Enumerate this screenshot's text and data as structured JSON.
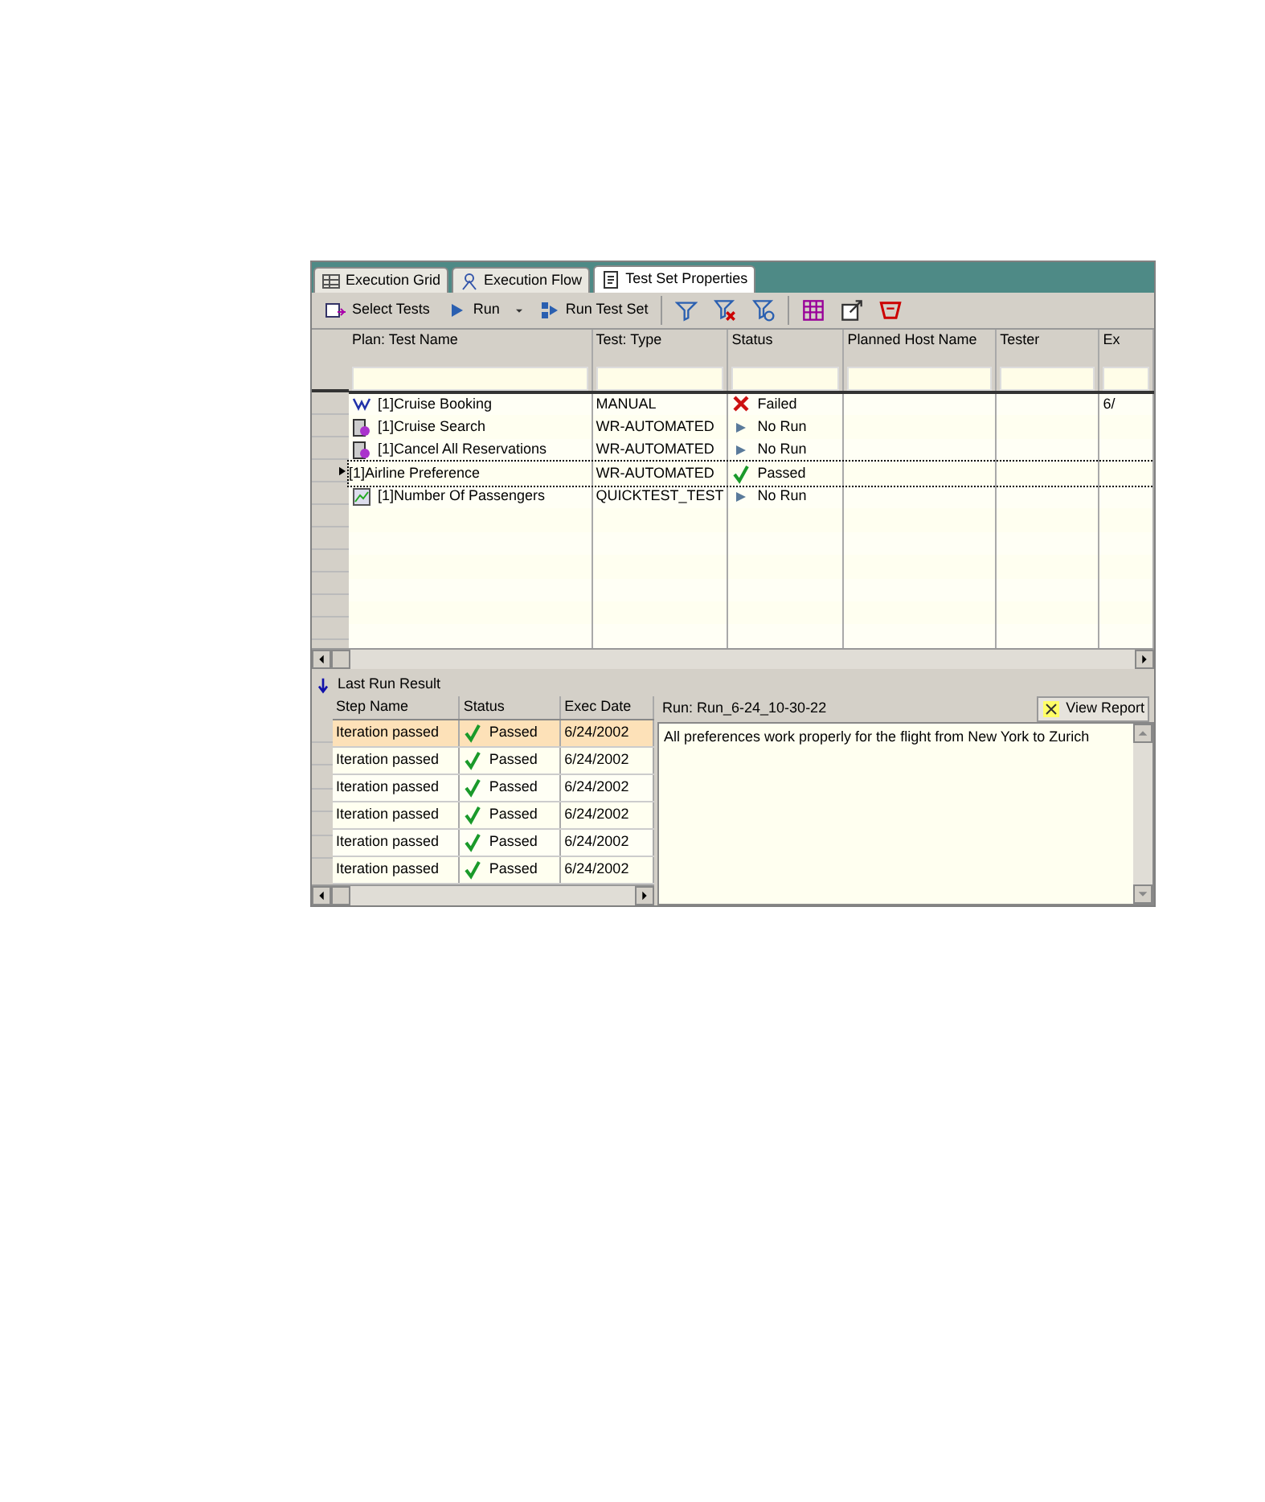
{
  "tabs": [
    {
      "label": "Execution Grid",
      "kind": "grid",
      "selected": false
    },
    {
      "label": "Execution Flow",
      "kind": "flow",
      "selected": false
    },
    {
      "label": "Test Set Properties",
      "kind": "props",
      "selected": true
    }
  ],
  "toolbar": [
    {
      "kind": "select",
      "label": "Select Tests"
    },
    {
      "kind": "run",
      "label": "Run"
    },
    {
      "kind": "runset",
      "label": "Run Test Set"
    },
    {
      "kind": "filter"
    },
    {
      "kind": "clearfilter"
    },
    {
      "kind": "refreshfilter"
    },
    {
      "kind": "columns"
    },
    {
      "kind": "export"
    },
    {
      "kind": "report"
    }
  ],
  "grid": {
    "columns": [
      "Plan: Test Name",
      "Test: Type",
      "Status",
      "Planned Host Name",
      "Tester",
      "Ex"
    ],
    "rows": [
      {
        "kind": "manual",
        "name": "[1]Cruise Booking",
        "type": "MANUAL",
        "status": {
          "kind": "failed",
          "label": "Failed"
        },
        "column_6": "6/",
        "current": false
      },
      {
        "kind": "automated",
        "name": "[1]Cruise Search",
        "type": "WR-AUTOMATED",
        "status": {
          "kind": "norun",
          "label": "No Run"
        },
        "current": false
      },
      {
        "kind": "automated",
        "name": "[1]Cancel All Reservations",
        "type": "WR-AUTOMATED",
        "status": {
          "kind": "norun",
          "label": "No Run"
        },
        "current": false
      },
      {
        "kind": "plain",
        "name": "[1]Airline Preference",
        "type": "WR-AUTOMATED",
        "status": {
          "kind": "passed",
          "label": "Passed"
        },
        "current": true
      },
      {
        "kind": "quicktest",
        "name": "[1]Number Of Passengers",
        "type": "QUICKTEST_TEST",
        "status": {
          "kind": "norun",
          "label": "No Run"
        },
        "current": false
      }
    ]
  },
  "last_run": {
    "title": "Last Run Result",
    "columns": [
      "Step Name",
      "Status",
      "Exec Date"
    ],
    "steps": [
      {
        "name": "Iteration passed",
        "status": "Passed",
        "date": "6/24/2002",
        "selected": true
      },
      {
        "name": "Iteration passed",
        "status": "Passed",
        "date": "6/24/2002",
        "selected": false
      },
      {
        "name": "Iteration passed",
        "status": "Passed",
        "date": "6/24/2002",
        "selected": false
      },
      {
        "name": "Iteration passed",
        "status": "Passed",
        "date": "6/24/2002",
        "selected": false
      },
      {
        "name": "Iteration passed",
        "status": "Passed",
        "date": "6/24/2002",
        "selected": false
      },
      {
        "name": "Iteration passed",
        "status": "Passed",
        "date": "6/24/2002",
        "selected": false
      }
    ],
    "run_label": "Run: Run_6-24_10-30-22",
    "view_report": "View Report",
    "description": "All preferences work properly for the flight from New York to Zurich"
  }
}
